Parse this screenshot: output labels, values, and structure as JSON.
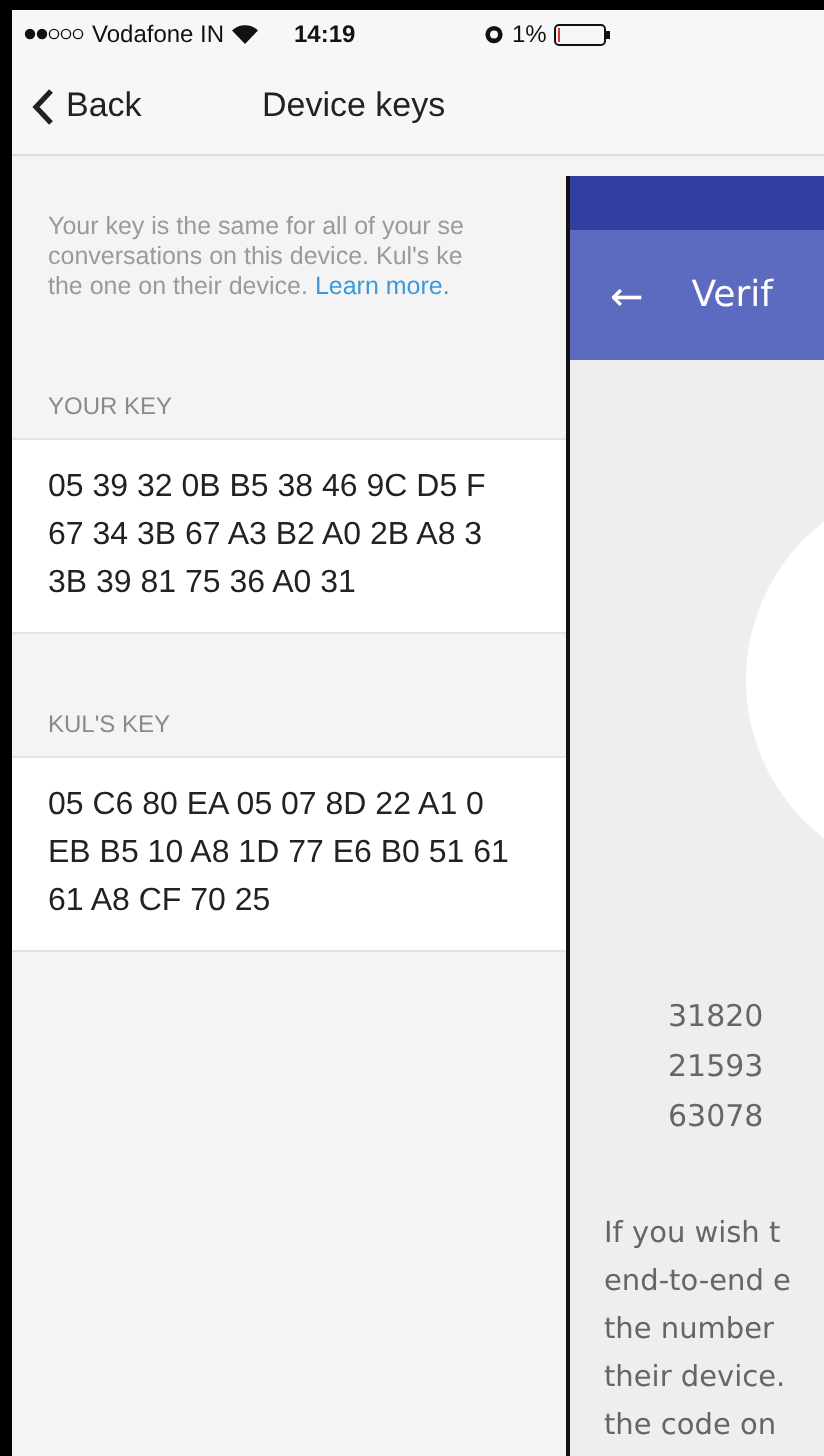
{
  "status_bar": {
    "carrier": "Vodafone IN",
    "time": "14:19",
    "battery": "1%"
  },
  "nav": {
    "back": "Back",
    "title": "Device keys"
  },
  "intro": {
    "lines": [
      "Your key is the same for all of your se",
      "conversations on this device. Kul's ke",
      "the one on their device."
    ],
    "link": "Learn more."
  },
  "keys": [
    {
      "label": "YOUR KEY",
      "lines": [
        "05 39 32 0B B5 38 46 9C D5 F",
        "67 34 3B 67 A3 B2 A0 2B A8 3",
        "3B 39 81 75 36 A0 31"
      ]
    },
    {
      "label": "KUL'S KEY",
      "lines": [
        "05 C6 80 EA 05 07 8D 22 A1 0",
        "EB B5 10 A8 1D 77 E6 B0 51 61",
        "61 A8 CF 70 25"
      ]
    }
  ],
  "verify": {
    "back": "←",
    "title": "Verif",
    "codes": [
      "31820",
      "21593",
      "63078"
    ],
    "text_lines": [
      "If you wish t",
      "end-to-end e",
      "the number",
      "their device.",
      "the code on"
    ]
  }
}
